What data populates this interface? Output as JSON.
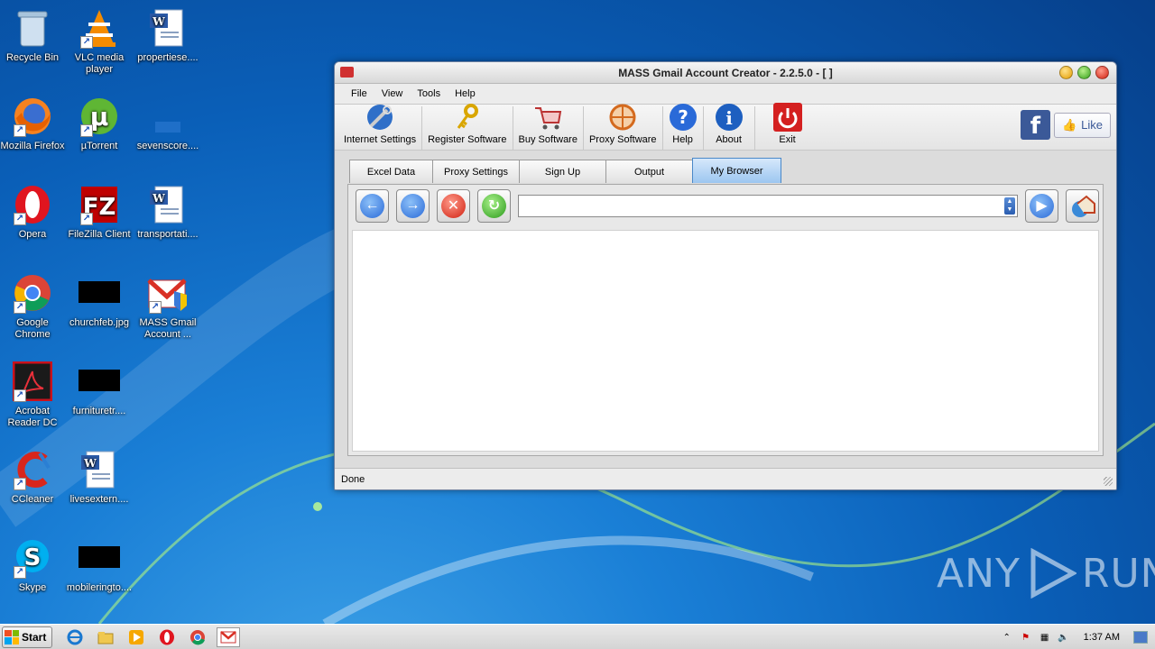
{
  "desktop": {
    "icons": [
      {
        "label": "Recycle Bin",
        "icon": "recycle-bin-icon"
      },
      {
        "label": "VLC media player",
        "icon": "vlc-icon"
      },
      {
        "label": "propertiese....",
        "icon": "word-doc-icon"
      },
      {
        "label": "Mozilla Firefox",
        "icon": "firefox-icon"
      },
      {
        "label": "µTorrent",
        "icon": "utorrent-icon"
      },
      {
        "label": "sevenscore....",
        "icon": "blank-file-icon"
      },
      {
        "label": "Opera",
        "icon": "opera-icon"
      },
      {
        "label": "FileZilla Client",
        "icon": "filezilla-icon"
      },
      {
        "label": "transportati....",
        "icon": "word-doc-icon"
      },
      {
        "label": "Google Chrome",
        "icon": "chrome-icon"
      },
      {
        "label": "churchfeb.jpg",
        "icon": "image-file-icon"
      },
      {
        "label": "MASS Gmail Account ...",
        "icon": "gmail-creator-icon"
      },
      {
        "label": "Acrobat Reader DC",
        "icon": "acrobat-icon"
      },
      {
        "label": "furnituretr....",
        "icon": "image-file-icon"
      },
      {
        "label": "CCleaner",
        "icon": "ccleaner-icon"
      },
      {
        "label": "livesextern....",
        "icon": "word-doc-icon"
      },
      {
        "label": "Skype",
        "icon": "skype-icon"
      },
      {
        "label": "mobileringto....",
        "icon": "image-file-icon"
      }
    ]
  },
  "window": {
    "title": "MASS Gmail Account Creator - 2.2.5.0 - [ ]",
    "menu": [
      "File",
      "View",
      "Tools",
      "Help"
    ],
    "toolbar": [
      {
        "label": "Internet Settings",
        "icon": "globe-wrench-icon"
      },
      {
        "label": "Register Software",
        "icon": "keys-icon"
      },
      {
        "label": "Buy Software",
        "icon": "cart-icon"
      },
      {
        "label": "Proxy Software",
        "icon": "proxy-globe-icon"
      },
      {
        "label": "Help",
        "icon": "help-icon"
      },
      {
        "label": "About",
        "icon": "info-icon"
      },
      {
        "label": "Exit",
        "icon": "power-icon"
      }
    ],
    "like_label": "Like",
    "tabs": [
      "Excel Data",
      "Proxy Settings",
      "Sign Up",
      "Output",
      "My Browser"
    ],
    "active_tab": "My Browser",
    "url": {
      "value": ""
    },
    "status": "Done"
  },
  "watermark": {
    "left": "ANY",
    "right": "RUN"
  },
  "taskbar": {
    "start_label": "Start",
    "clock": "1:37 AM"
  },
  "colors": {
    "accent": "#3b5998",
    "active_tab": "#9cc6f0",
    "exit_red": "#d42020"
  }
}
